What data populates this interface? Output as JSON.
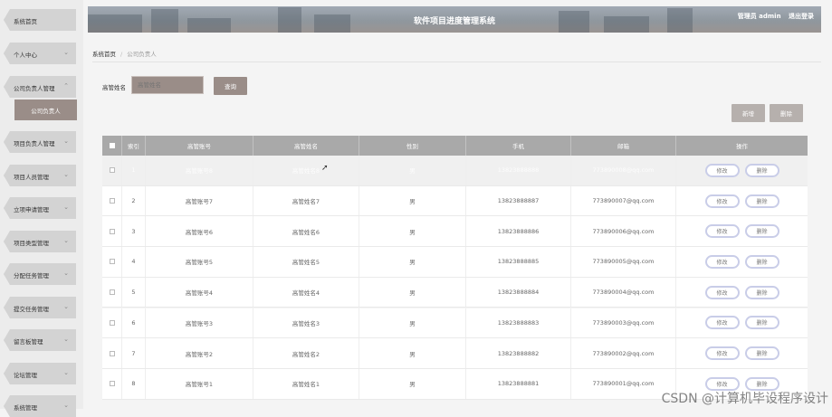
{
  "header": {
    "title": "软件项目进度管理系统",
    "user_label": "管理员 admin",
    "logout_label": "退出登录"
  },
  "sidebar": {
    "items": [
      {
        "label": "系统首页",
        "has_chevron": false
      },
      {
        "label": "个人中心",
        "has_chevron": true
      },
      {
        "label": "公司负责人管理",
        "has_chevron": true,
        "expanded": true,
        "children": [
          "公司负责人"
        ]
      },
      {
        "label": "项目负责人管理",
        "has_chevron": true
      },
      {
        "label": "项目人员管理",
        "has_chevron": true
      },
      {
        "label": "立项申请管理",
        "has_chevron": true
      },
      {
        "label": "项目类型管理",
        "has_chevron": true
      },
      {
        "label": "分配任务管理",
        "has_chevron": true
      },
      {
        "label": "提交任务管理",
        "has_chevron": true
      },
      {
        "label": "留言板管理",
        "has_chevron": true
      },
      {
        "label": "论坛管理",
        "has_chevron": true
      },
      {
        "label": "系统管理",
        "has_chevron": true
      }
    ]
  },
  "breadcrumb": {
    "home": "系统首页",
    "separator": "/",
    "current": "公司负责人"
  },
  "search": {
    "label": "高管姓名",
    "placeholder": "高管姓名",
    "value": "",
    "button": "查询"
  },
  "actions": {
    "add": "新增",
    "delete": "删除"
  },
  "table": {
    "columns": [
      "索引",
      "高管账号",
      "高管姓名",
      "性别",
      "手机",
      "邮箱",
      "操作"
    ],
    "row_actions": {
      "edit": "修改",
      "delete": "删除"
    },
    "rows": [
      {
        "index": "1",
        "account": "高管账号8",
        "name": "高管姓名8",
        "gender": "男",
        "phone": "13823888888",
        "email": "773890008@qq.com",
        "hovered": true
      },
      {
        "index": "2",
        "account": "高管账号7",
        "name": "高管姓名7",
        "gender": "男",
        "phone": "13823888887",
        "email": "773890007@qq.com"
      },
      {
        "index": "3",
        "account": "高管账号6",
        "name": "高管姓名6",
        "gender": "男",
        "phone": "13823888886",
        "email": "773890006@qq.com"
      },
      {
        "index": "4",
        "account": "高管账号5",
        "name": "高管姓名5",
        "gender": "男",
        "phone": "13823888885",
        "email": "773890005@qq.com"
      },
      {
        "index": "5",
        "account": "高管账号4",
        "name": "高管姓名4",
        "gender": "男",
        "phone": "13823888884",
        "email": "773890004@qq.com"
      },
      {
        "index": "6",
        "account": "高管账号3",
        "name": "高管姓名3",
        "gender": "男",
        "phone": "13823888883",
        "email": "773890003@qq.com"
      },
      {
        "index": "7",
        "account": "高管账号2",
        "name": "高管姓名2",
        "gender": "男",
        "phone": "13823888882",
        "email": "773890002@qq.com"
      },
      {
        "index": "8",
        "account": "高管账号1",
        "name": "高管姓名1",
        "gender": "男",
        "phone": "13823888881",
        "email": "773890001@qq.com"
      }
    ]
  },
  "watermark": "CSDN @计算机毕设程序设计",
  "colors": {
    "accent": "#9a8d88",
    "header_bar": "#a9a9a9",
    "pill_border": "#c9cde8"
  }
}
